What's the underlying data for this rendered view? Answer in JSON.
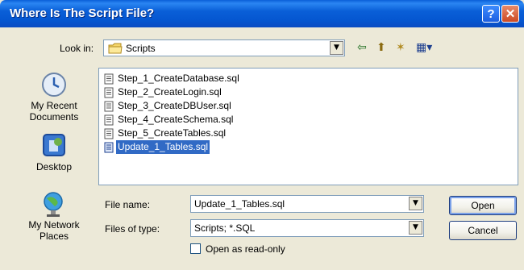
{
  "window": {
    "title": "Where Is The Script File?",
    "help_glyph": "?",
    "close_glyph": "✕"
  },
  "lookin": {
    "label": "Look in:",
    "value": "Scripts"
  },
  "toolbar": {
    "back_glyph": "⇦",
    "up_glyph": "⬆",
    "new_folder_glyph": "✶",
    "views_glyph": "▦▾"
  },
  "places": [
    {
      "label": "My Recent\nDocuments",
      "icon": "recent-documents-icon"
    },
    {
      "label": "Desktop",
      "icon": "desktop-icon"
    },
    {
      "label": "My Network\nPlaces",
      "icon": "network-places-icon"
    }
  ],
  "files": [
    {
      "name": "Step_1_CreateDatabase.sql",
      "selected": false
    },
    {
      "name": "Step_2_CreateLogin.sql",
      "selected": false
    },
    {
      "name": "Step_3_CreateDBUser.sql",
      "selected": false
    },
    {
      "name": "Step_4_CreateSchema.sql",
      "selected": false
    },
    {
      "name": "Step_5_CreateTables.sql",
      "selected": false
    },
    {
      "name": "Update_1_Tables.sql",
      "selected": true
    }
  ],
  "filename": {
    "label": "File name:",
    "value": "Update_1_Tables.sql"
  },
  "filetype": {
    "label": "Files of type:",
    "value": "Scripts; *.SQL"
  },
  "readonly": {
    "label": "Open as read-only",
    "checked": false
  },
  "buttons": {
    "open": "Open",
    "cancel": "Cancel"
  },
  "colors": {
    "title_bar": "#0a5fd8",
    "selection": "#316ac5",
    "dialog_bg": "#ece9d8"
  }
}
